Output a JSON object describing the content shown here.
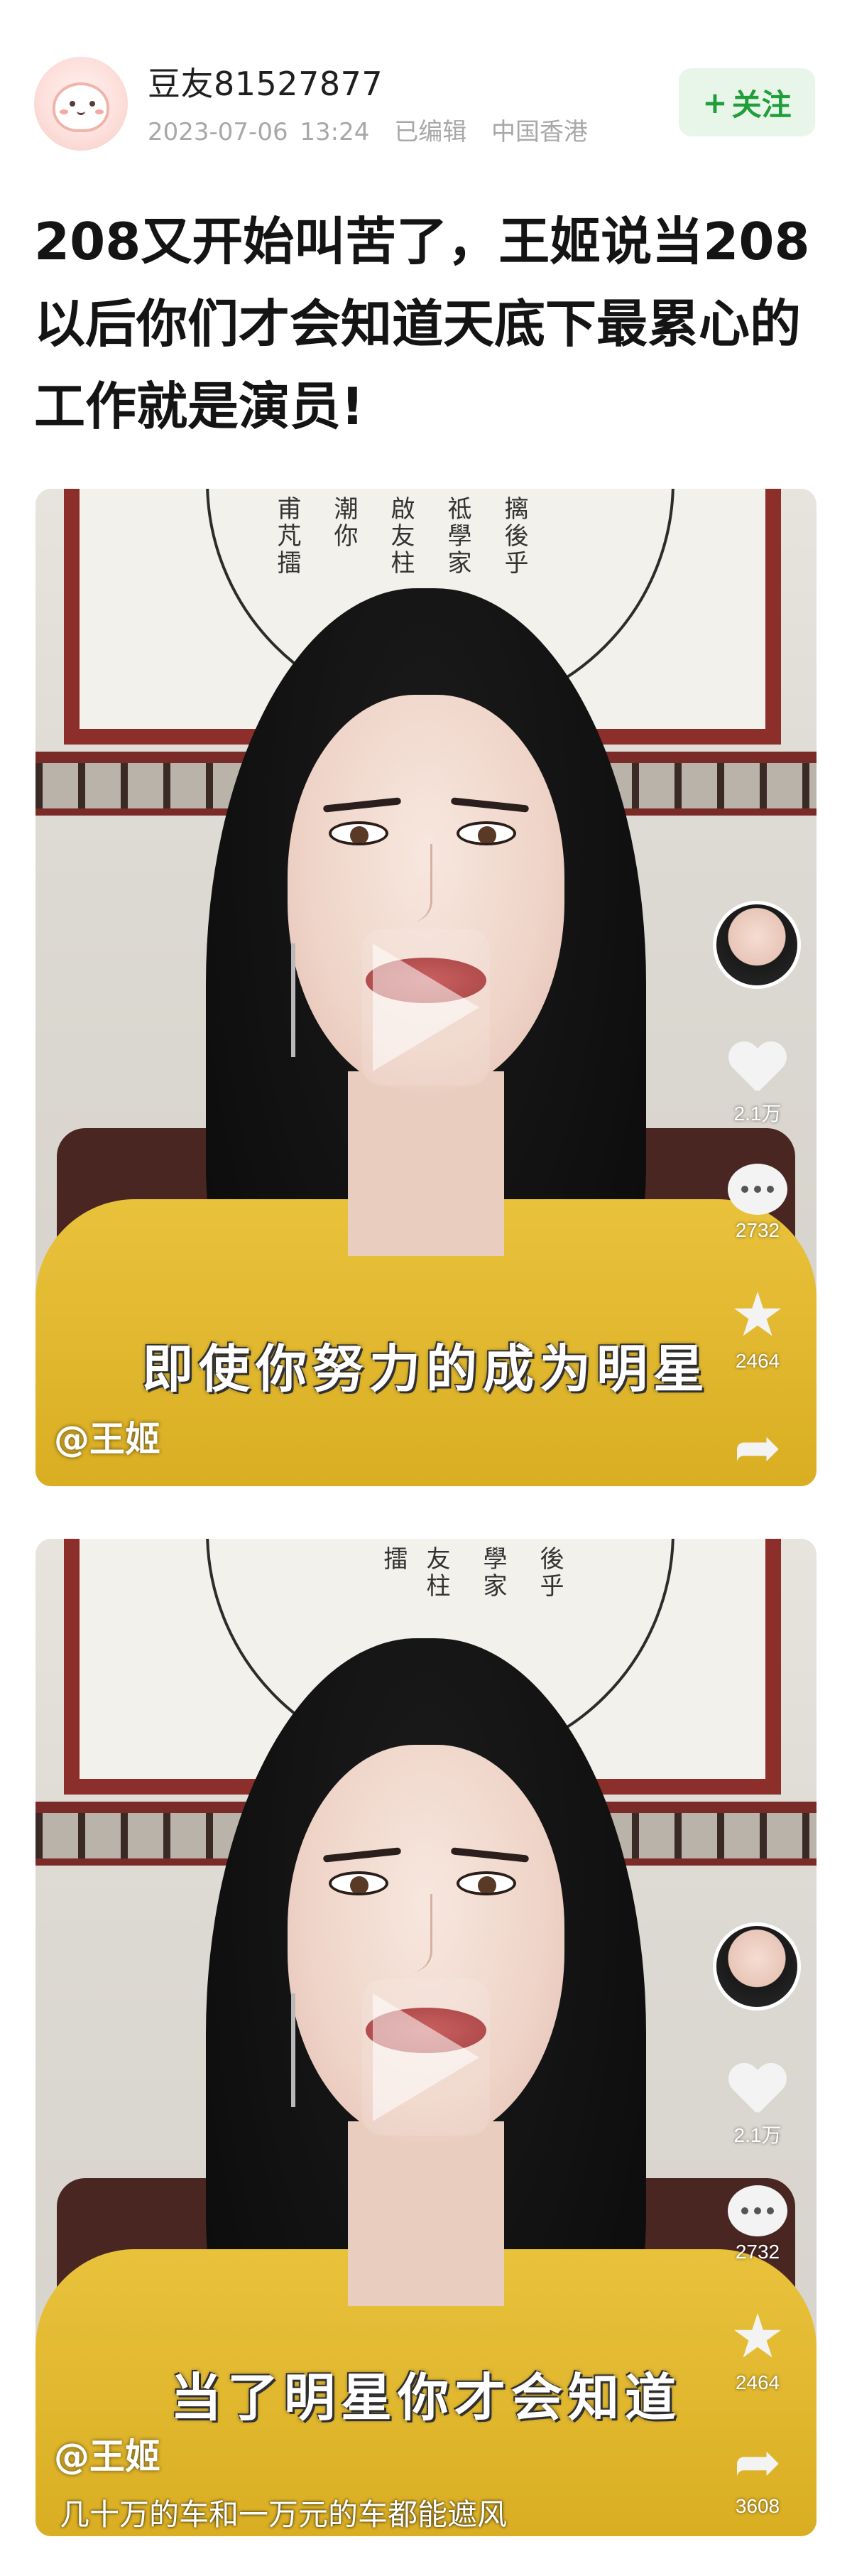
{
  "post": {
    "author": "豆友81527877",
    "date": "2023-07-06 13:24",
    "edited": "已编辑",
    "location": "中国香港",
    "follow_label": "关注",
    "follow_plus": "+",
    "title": "208又开始叫苦了，王姬说当208以后你们才会知道天底下最累心的工作就是演员!"
  },
  "videos": [
    {
      "caption": "即使你努力的成为明星",
      "handle": "@王姬",
      "sub_caption": "",
      "likes": "2.1万",
      "comments": "2732",
      "favorites": "2464",
      "shares": ""
    },
    {
      "caption": "当了明星你才会知道",
      "handle": "@王姬",
      "sub_caption": "几十万的车和一万元的车都能遮风",
      "likes": "2.1万",
      "comments": "2732",
      "favorites": "2464",
      "shares": "3608"
    }
  ],
  "icons": {
    "avatar": "cartoon-avatar-icon",
    "like": "heart-icon",
    "comment": "comment-bubble-icon",
    "favorite": "star-icon",
    "share": "share-arrow-icon",
    "play": "play-icon"
  },
  "colors": {
    "follow_bg": "#e8f6ea",
    "follow_text": "#1f9e3a",
    "meta_text": "#a8a8a8"
  }
}
